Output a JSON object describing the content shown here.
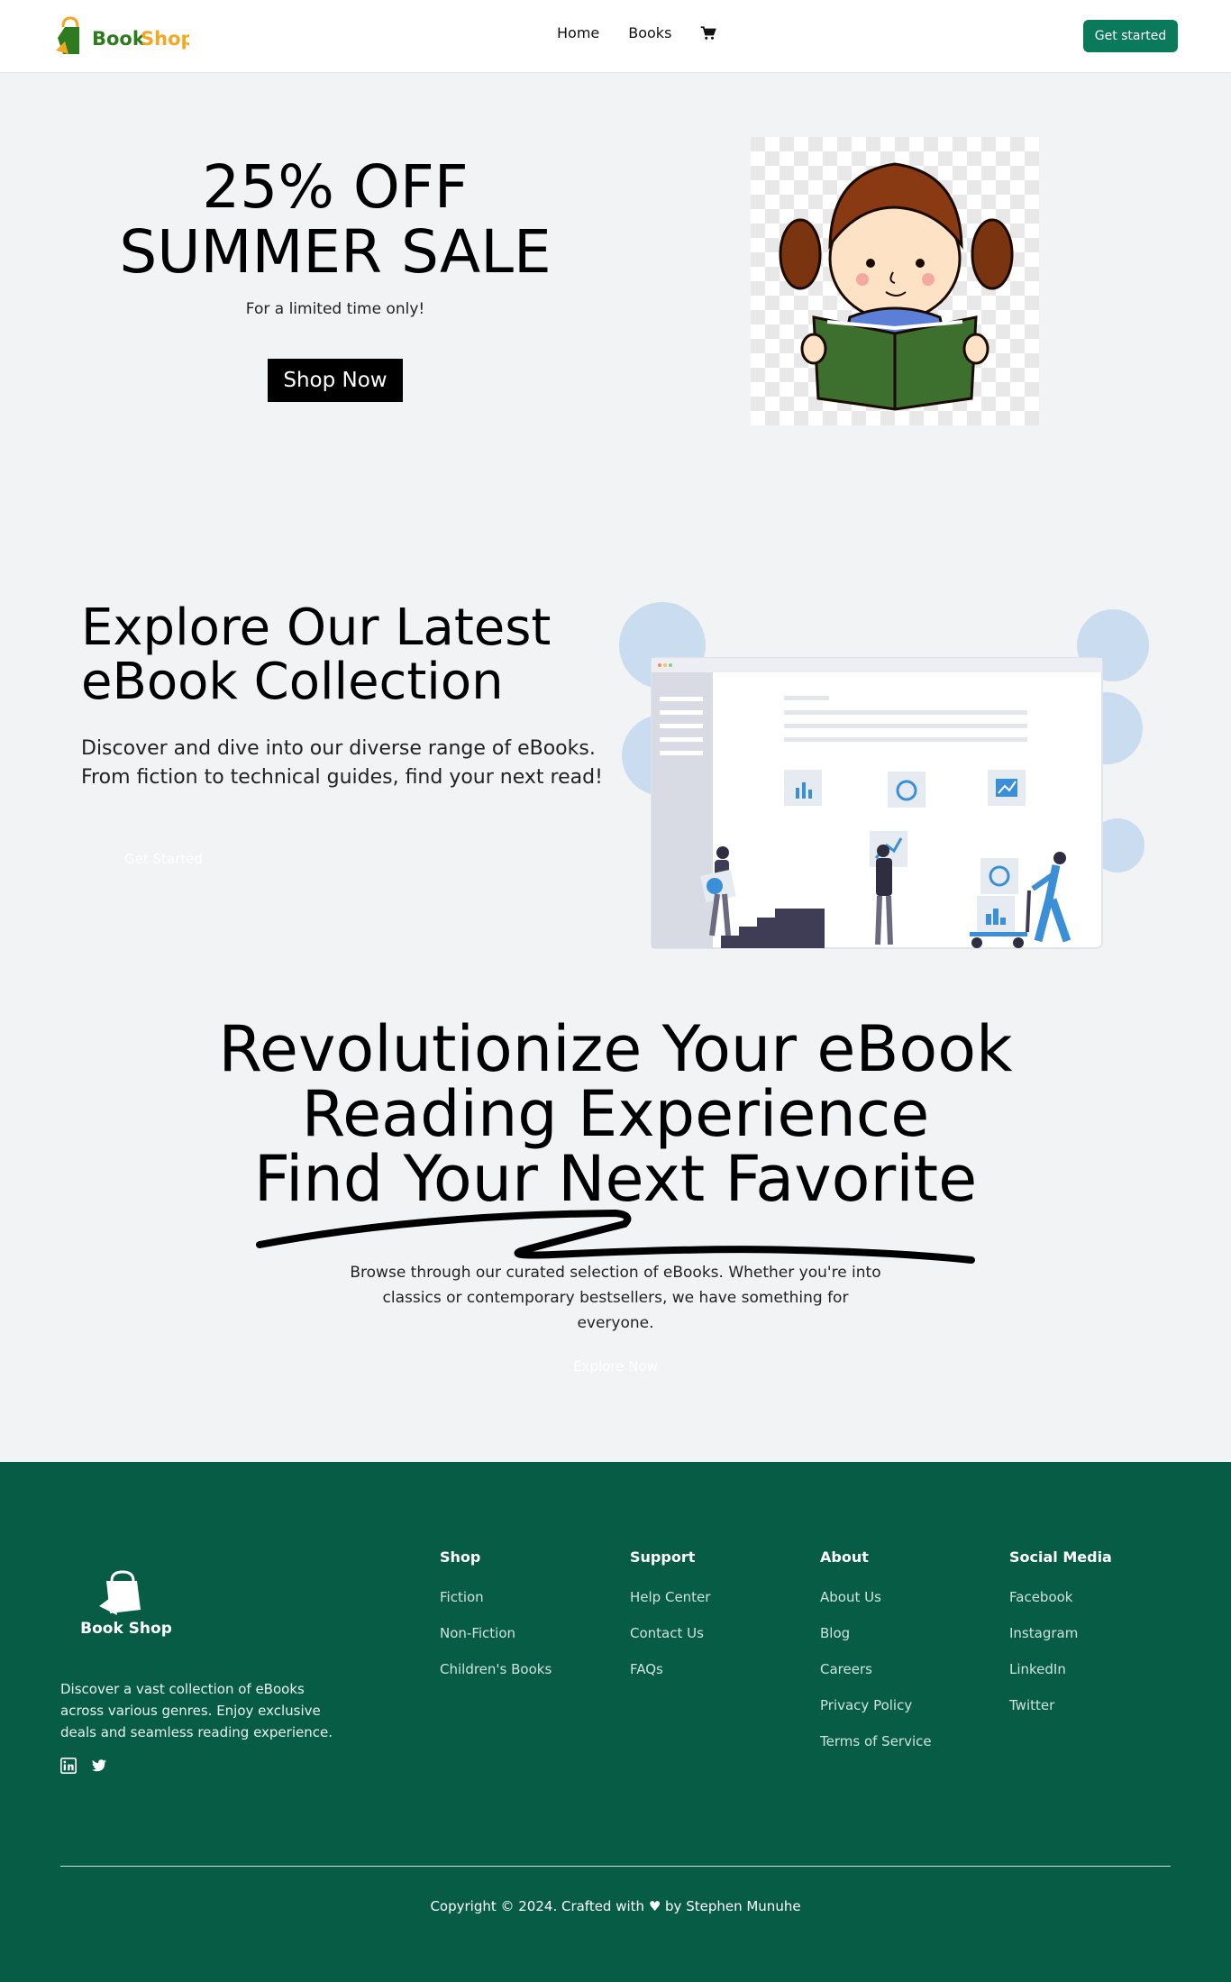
{
  "nav": {
    "logo_text_1": "Book",
    "logo_text_2": "Shop",
    "links": [
      "Home",
      "Books"
    ],
    "cta": "Get started"
  },
  "hero": {
    "title_line1": "25% OFF",
    "title_line2": "SUMMER SALE",
    "subtitle": "For a limited time only!",
    "button": "Shop Now"
  },
  "explore": {
    "title_line1": "Explore Our Latest",
    "title_line2": "eBook Collection",
    "text_line1": "Discover and dive into our diverse range of eBooks.",
    "text_line2": "From fiction to technical guides, find your next read!",
    "button": "Get Started"
  },
  "revolution": {
    "title_line1": "Revolutionize Your eBook",
    "title_line2": "Reading Experience",
    "title_line3": "Find Your Next Favorite",
    "text_line1": "Browse through our curated selection of eBooks. Whether you're into",
    "text_line2": "classics or contemporary bestsellers, we have something for everyone.",
    "button": "Explore Now"
  },
  "footer": {
    "logo_text": "Book Shop",
    "description": "Discover a vast collection of eBooks across various genres. Enjoy exclusive deals and seamless reading experience.",
    "columns": [
      {
        "title": "Shop",
        "items": [
          "Fiction",
          "Non-Fiction",
          "Children's Books"
        ]
      },
      {
        "title": "Support",
        "items": [
          "Help Center",
          "Contact Us",
          "FAQs"
        ]
      },
      {
        "title": "About",
        "items": [
          "About Us",
          "Blog",
          "Careers",
          "Privacy Policy",
          "Terms of Service"
        ]
      },
      {
        "title": "Social Media",
        "items": [
          "Facebook",
          "Instagram",
          "LinkedIn",
          "Twitter"
        ]
      }
    ],
    "copyright": "Copyright © 2024. Crafted with ♥ by Stephen Munuhe"
  },
  "colors": {
    "brand_green": "#0a7a5a",
    "footer_bg": "#075c45",
    "logo_orange": "#f5a623",
    "logo_green": "#2d7a1f"
  },
  "icons": [
    "cart-icon",
    "linkedin-icon",
    "twitter-icon",
    "shopping-bag-icon"
  ]
}
